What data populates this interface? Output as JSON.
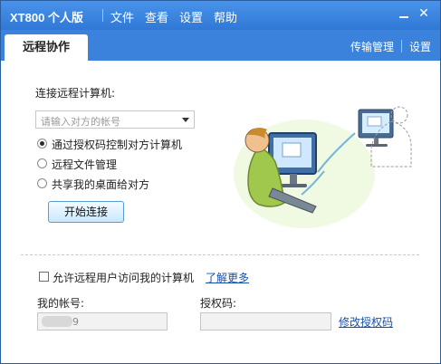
{
  "window": {
    "title": "XT800 个人版"
  },
  "menu": {
    "items": [
      "文件",
      "查看",
      "设置",
      "帮助"
    ]
  },
  "tabs": {
    "active_tab": "远程协作",
    "links": [
      "传输管理",
      "设置"
    ]
  },
  "connect": {
    "label": "连接远程计算机:",
    "placeholder": "请输入对方的帐号",
    "options": [
      {
        "label": "通过授权码控制对方计算机",
        "checked": true
      },
      {
        "label": "远程文件管理",
        "checked": false
      },
      {
        "label": "共享我的桌面给对方",
        "checked": false
      }
    ],
    "start_button": "开始连接"
  },
  "access": {
    "allow_label": "允许远程用户访问我的计算机",
    "allow_checked": false,
    "learn_more": "了解更多",
    "account_label": "我的帐号:",
    "account_value_visible": "9",
    "auth_label": "授权码:",
    "auth_value": "",
    "modify_link": "修改授权码"
  },
  "colors": {
    "title_bar": "#2f78d6",
    "tab_bar": "#3a82dc",
    "link": "#1a4fa8",
    "button_border": "#5a9bd5"
  }
}
